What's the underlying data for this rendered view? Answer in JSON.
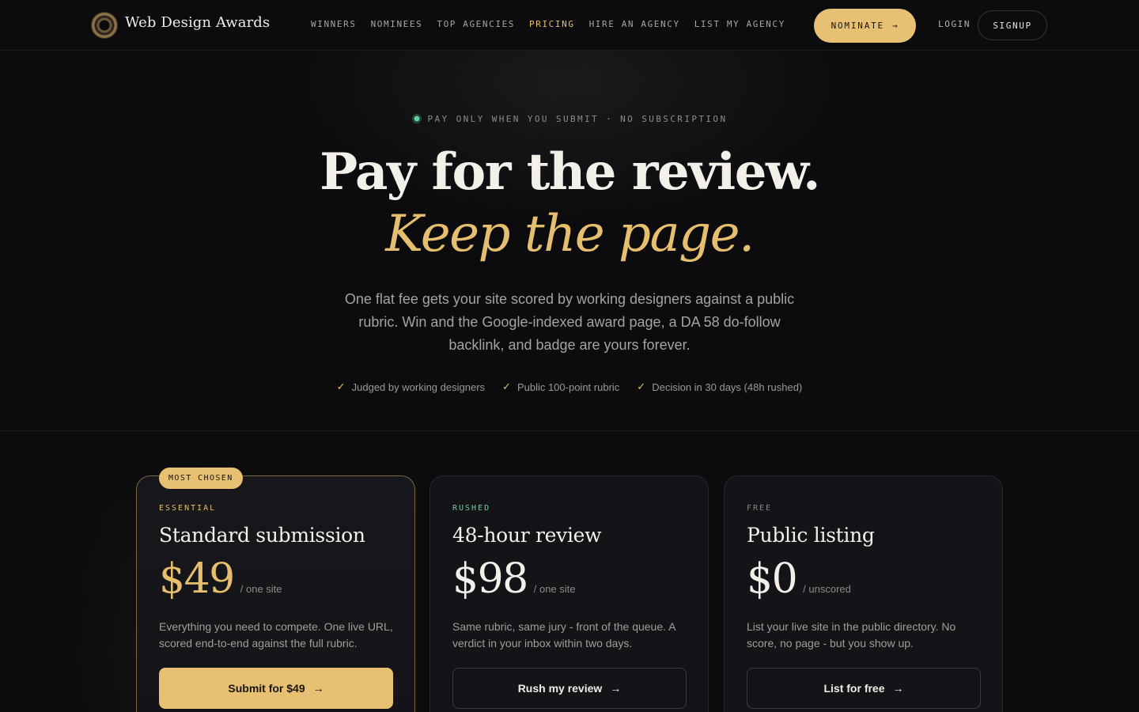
{
  "nav": {
    "brand": "Web Design Awards",
    "links": [
      {
        "label": "WINNERS",
        "active": false
      },
      {
        "label": "NOMINEES",
        "active": false
      },
      {
        "label": "TOP AGENCIES",
        "active": false
      },
      {
        "label": "PRICING",
        "active": true
      },
      {
        "label": "HIRE AN AGENCY",
        "active": false
      },
      {
        "label": "LIST MY AGENCY",
        "active": false
      }
    ],
    "nominate": "NOMINATE",
    "arrow": "→",
    "login": "LOGIN",
    "signup": "SIGNUP"
  },
  "hero": {
    "eyebrow": "PAY ONLY WHEN YOU SUBMIT · NO SUBSCRIPTION",
    "title": "Pay for the review.",
    "title_italic": "Keep the page.",
    "lead": "One flat fee gets your site scored by working designers against a public rubric. Win and the Google-indexed award page, a DA 58 do-follow backlink, and badge are yours forever.",
    "checks": [
      "Judged by working designers",
      "Public 100-point rubric",
      "Decision in 30 days (48h rushed)"
    ]
  },
  "plans": [
    {
      "badge": "MOST CHOSEN",
      "tier": "ESSENTIAL",
      "tier_color": "#e6bf6e",
      "title": "Standard submission",
      "price": "$49",
      "unit": "/ one site",
      "desc": "Everything you need to compete. One live URL, scored end-to-end against the full rubric.",
      "cta": "Submit for $49",
      "arrow": "→"
    },
    {
      "tier": "RUSHED",
      "tier_color": "#6fcf9e",
      "title": "48-hour review",
      "price": "$98",
      "unit": "/ one site",
      "desc": "Same rubric, same jury - front of the queue. A verdict in your inbox within two days.",
      "cta": "Rush my review",
      "arrow": "→"
    },
    {
      "tier": "FREE",
      "tier_color": "#8e8a84",
      "title": "Public listing",
      "price": "$0",
      "unit": "/ unscored",
      "desc": "List your live site in the public directory. No score, no page - but you show up.",
      "cta": "List for free",
      "arrow": "→"
    }
  ]
}
